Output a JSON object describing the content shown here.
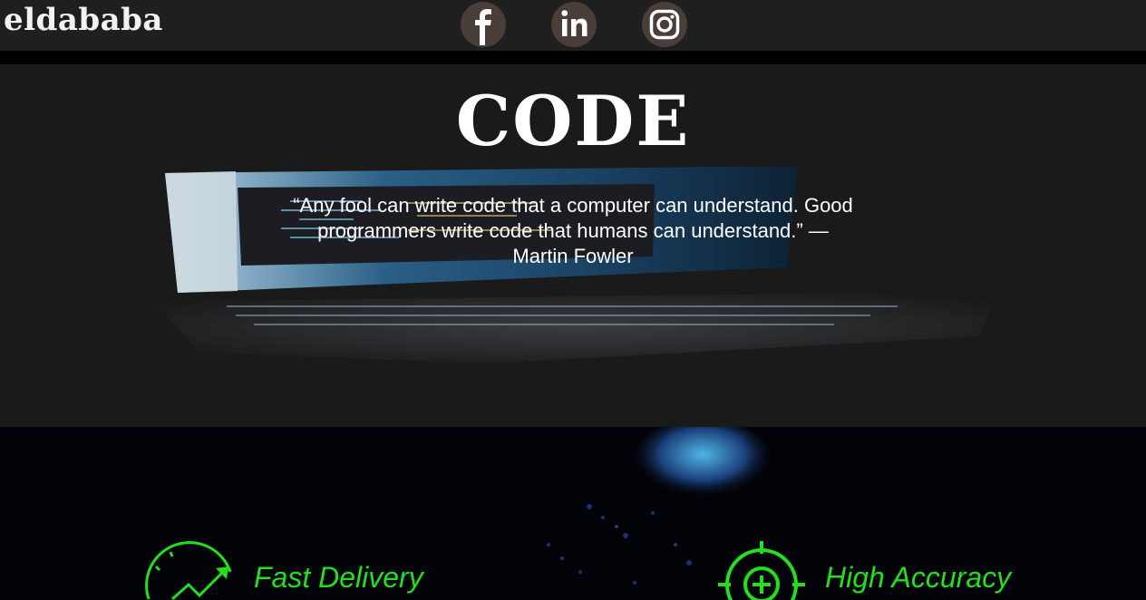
{
  "header": {
    "logo": "eldababa",
    "social": [
      {
        "name": "facebook",
        "icon": "facebook-icon"
      },
      {
        "name": "linkedin",
        "icon": "linkedin-icon"
      },
      {
        "name": "instagram",
        "icon": "instagram-icon"
      }
    ]
  },
  "hero": {
    "title": "CODE",
    "quote": "“Any fool can write code that a computer can understand. Good programmers write code that humans can understand.” — Martin Fowler"
  },
  "features": {
    "items": [
      {
        "label": "Fast Delivery",
        "icon": "speedometer-icon"
      },
      {
        "label": "High Accuracy",
        "icon": "crosshair-icon"
      }
    ]
  },
  "colors": {
    "topbar": "#1f1f1f",
    "social_bg": "#4a3f38",
    "accent_green": "#22e01c",
    "hero_bg": "#1a1a1a"
  }
}
